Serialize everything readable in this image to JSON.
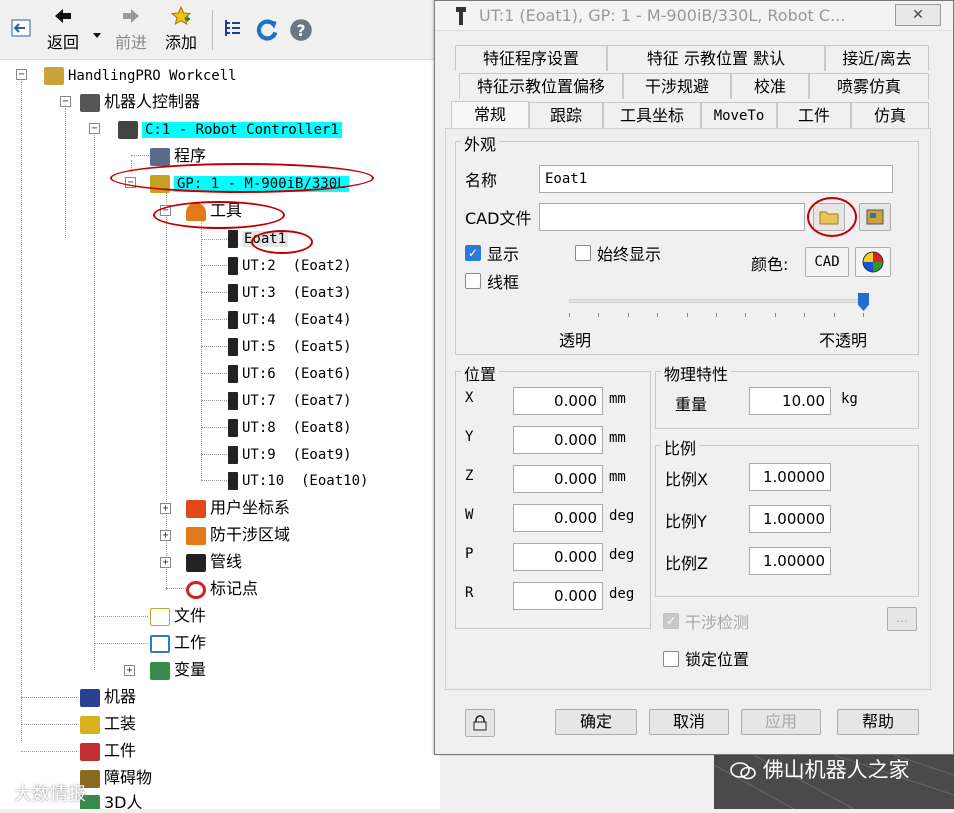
{
  "toolbar": {
    "back_label": "返回",
    "forward_label": "前进",
    "add_label": "添加"
  },
  "tree": {
    "workcell": "HandlingPRO Workcell",
    "robot_controllers": "机器人控制器",
    "controller": "C:1 - Robot Controller1",
    "programs": "程序",
    "group": "GP: 1 - M-900iB/330L",
    "tools": "工具",
    "tool_items": [
      "Eoat1",
      "UT:2  (Eoat2)",
      "UT:3  (Eoat3)",
      "UT:4  (Eoat4)",
      "UT:5  (Eoat5)",
      "UT:6  (Eoat6)",
      "UT:7  (Eoat7)",
      "UT:8  (Eoat8)",
      "UT:9  (Eoat9)",
      "UT:10  (Eoat10)"
    ],
    "user_frames": "用户坐标系",
    "interference_zones": "防干涉区域",
    "cables": "管线",
    "marker_points": "标记点",
    "files": "文件",
    "jobs": "工作",
    "variables": "变量",
    "machines": "机器",
    "fixtures": "工装",
    "parts": "工件",
    "obstacles": "障碍物",
    "humans": "3D人"
  },
  "dialog": {
    "title": "UT:1  (Eoat1), GP: 1 - M-900iB/330L, Robot C...",
    "tabs_row1": [
      "特征程序设置",
      "特征 示教位置 默认",
      "接近/离去"
    ],
    "tabs_row2": [
      "特征示教位置偏移",
      "干涉规避",
      "校准",
      "喷雾仿真"
    ],
    "tabs_row3": [
      "常规",
      "跟踪",
      "工具坐标",
      "MoveTo",
      "工件",
      "仿真"
    ],
    "appearance": {
      "group_label": "外观",
      "name_label": "名称",
      "name_value": "Eoat1",
      "cad_label": "CAD文件",
      "cad_value": "",
      "show_label": "显示",
      "show_checked": true,
      "always_show_label": "始终显示",
      "always_show_checked": false,
      "wireframe_label": "线框",
      "wireframe_checked": false,
      "color_label": "颜色:",
      "cad_button": "CAD",
      "transparent_label": "透明",
      "opaque_label": "不透明",
      "opacity": 1.0
    },
    "position": {
      "group_label": "位置",
      "fields": [
        {
          "label": "X",
          "value": "0.000",
          "unit": "mm"
        },
        {
          "label": "Y",
          "value": "0.000",
          "unit": "mm"
        },
        {
          "label": "Z",
          "value": "0.000",
          "unit": "mm"
        },
        {
          "label": "W",
          "value": "0.000",
          "unit": "deg"
        },
        {
          "label": "P",
          "value": "0.000",
          "unit": "deg"
        },
        {
          "label": "R",
          "value": "0.000",
          "unit": "deg"
        }
      ]
    },
    "physical": {
      "group_label": "物理特性",
      "weight_label": "重量",
      "weight_value": "10.00",
      "weight_unit": "kg"
    },
    "scale": {
      "group_label": "比例",
      "fields": [
        {
          "label": "比例X",
          "value": "1.00000"
        },
        {
          "label": "比例Y",
          "value": "1.00000"
        },
        {
          "label": "比例Z",
          "value": "1.00000"
        }
      ]
    },
    "interference_check_label": "干涉检测",
    "interference_check_checked": true,
    "more_button": "...",
    "lock_position_label": "锁定位置",
    "lock_position_checked": false,
    "ok_button": "确定",
    "cancel_button": "取消",
    "apply_button": "应用",
    "help_button": "帮助"
  },
  "watermark": {
    "left": "大数情报",
    "right": "佛山机器人之家"
  },
  "colors": {
    "highlight": "#00ffff",
    "annotation_oval": "#c00000",
    "checkbox_checked": "#2a7bd4"
  }
}
